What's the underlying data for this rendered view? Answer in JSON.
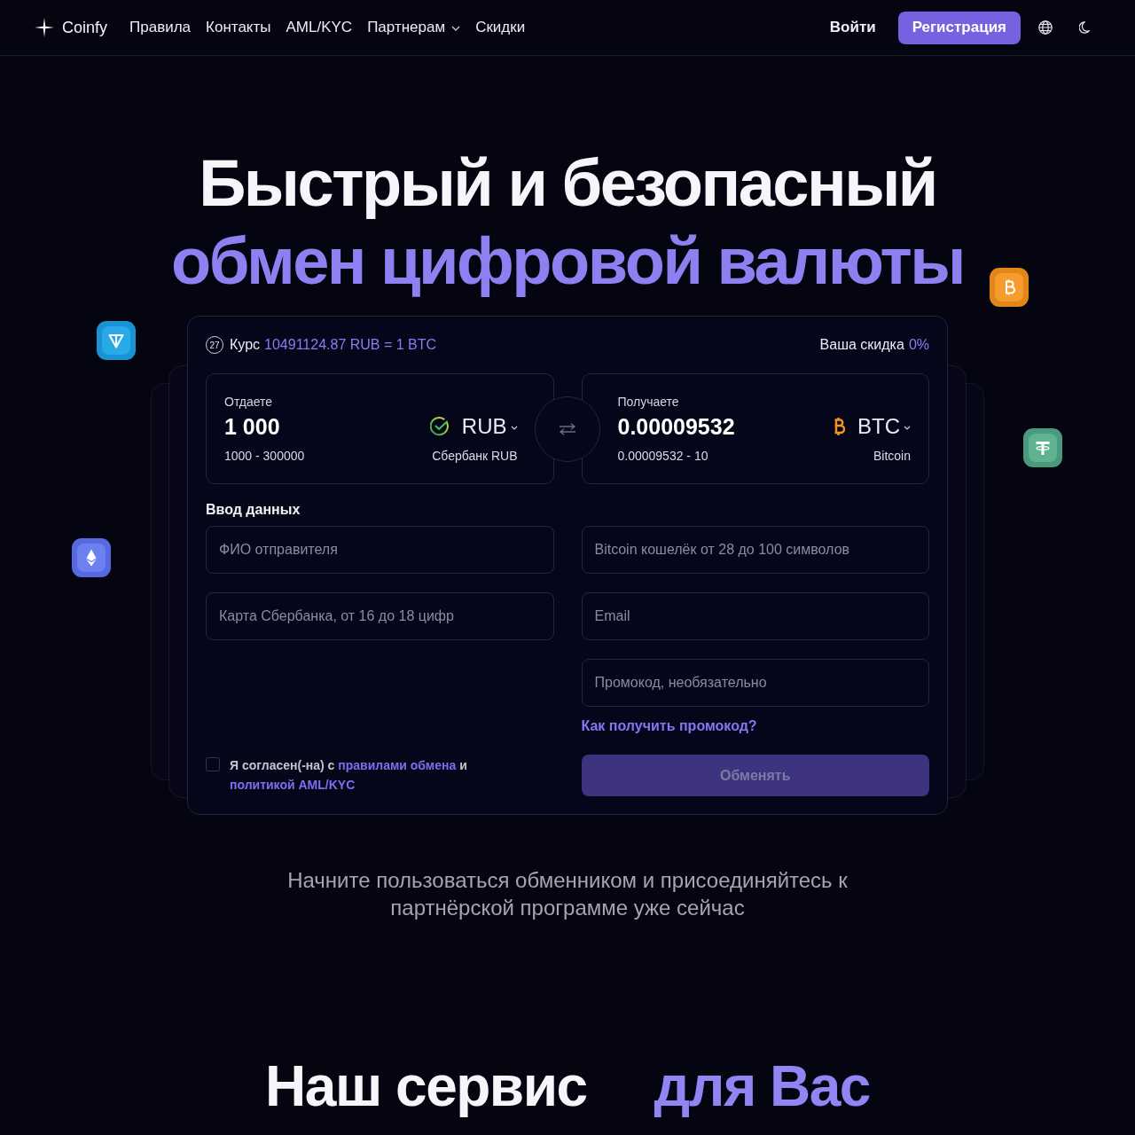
{
  "header": {
    "logo": "Coinfy",
    "nav": [
      {
        "label": "Правила",
        "has_dropdown": false
      },
      {
        "label": "Контакты",
        "has_dropdown": false
      },
      {
        "label": "AML/KYC",
        "has_dropdown": false
      },
      {
        "label": "Партнерам",
        "has_dropdown": true
      },
      {
        "label": "Скидки",
        "has_dropdown": false
      }
    ],
    "login": "Войти",
    "register": "Регистрация"
  },
  "hero": {
    "title": "Быстрый и безопасный",
    "title_highlight": "обмен цифровой валюты"
  },
  "exchange": {
    "timer": "27",
    "rate_label": "Курс",
    "rate": "10491124.87 RUB = 1 BTC",
    "discount_label": "Ваша скидка",
    "discount": "0%",
    "give": {
      "label": "Отдаете",
      "amount": "1 000",
      "range": "1000 - 300000",
      "currency": "RUB",
      "method": "Сбербанк RUB"
    },
    "get": {
      "label": "Получаете",
      "amount": "0.00009532",
      "range": "0.00009532 - 10",
      "currency": "BTC",
      "method": "Bitcoin"
    }
  },
  "form": {
    "title": "Ввод данных",
    "left_fields": [
      {
        "placeholder": "ФИО отправителя"
      },
      {
        "placeholder": "Карта Сбербанка, от 16 до 18 цифр"
      }
    ],
    "right_fields": [
      {
        "placeholder": "Bitcoin кошелёк от 28 до 100 символов"
      },
      {
        "placeholder": "Email"
      },
      {
        "placeholder": "Промокод, необязательно"
      }
    ],
    "promo_link": "Как получить промокод?",
    "agreement": {
      "checked": false,
      "parts": [
        {
          "kind": "text",
          "text": "Я согласен(-на) с"
        },
        {
          "kind": "link",
          "text": "правилами обмена"
        },
        {
          "kind": "text",
          "text": "и"
        },
        {
          "kind": "link",
          "text": "политикой AML/KYC"
        }
      ]
    },
    "submit": {
      "label": "Обменять",
      "disabled": true
    }
  },
  "cta": "Начните пользоваться обменником и присоединяйтесь к партнёрской программе уже сейчас",
  "section_title": {
    "text": "Наш сервис",
    "highlight": "для Вас"
  }
}
